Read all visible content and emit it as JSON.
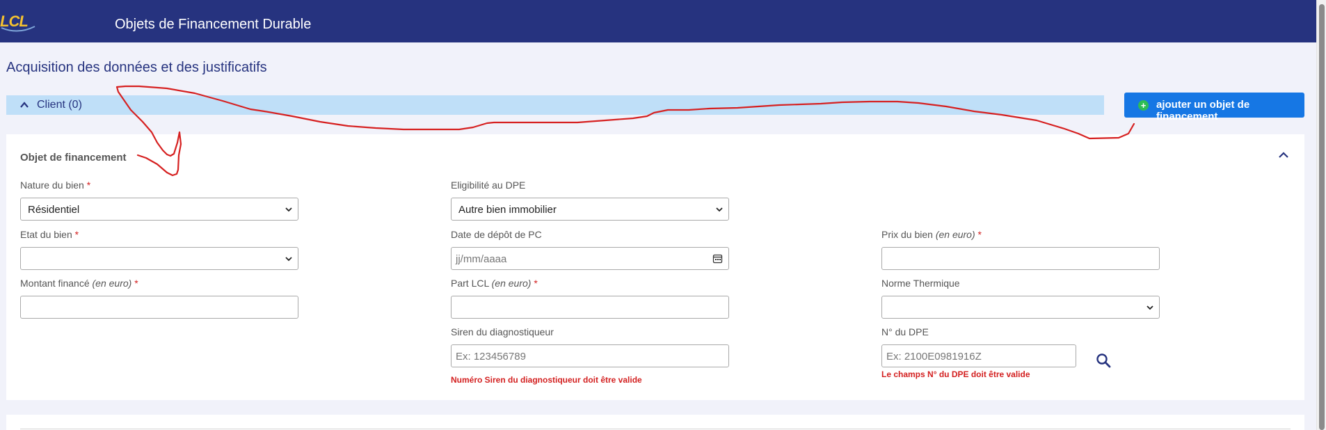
{
  "header": {
    "logo_text": "LCL",
    "title": "Objets de Financement Durable"
  },
  "page": {
    "title": "Acquisition des données et des justificatifs"
  },
  "client_section": {
    "label": "Client (0)"
  },
  "add_button": {
    "label": "ajouter un objet de financement",
    "icon": "plus-circle-icon"
  },
  "form": {
    "title": "Objet de financement",
    "nature": {
      "label": "Nature du bien",
      "required": "*",
      "value": "Résidentiel"
    },
    "eligibilite": {
      "label": "Eligibilité au DPE",
      "value": "Autre bien immobilier"
    },
    "etat": {
      "label": "Etat du bien",
      "required": "*",
      "value": ""
    },
    "date_pc": {
      "label": "Date de dépôt de PC",
      "placeholder": "jj/mm/aaaa"
    },
    "prix": {
      "label": "Prix du bien",
      "unit": "(en euro)",
      "required": "*",
      "value": ""
    },
    "montant": {
      "label": "Montant financé",
      "unit": "(en euro)",
      "required": "*",
      "value": ""
    },
    "part_lcl": {
      "label": "Part LCL",
      "unit": "(en euro)",
      "required": "*",
      "value": ""
    },
    "norme": {
      "label": "Norme Thermique",
      "value": ""
    },
    "siren": {
      "label": "Siren du diagnostiqueur",
      "placeholder": "Ex: 123456789",
      "error": "Numéro Siren du diagnostiqueur doit être valide"
    },
    "dpe": {
      "label": "N° du DPE",
      "placeholder": "Ex: 2100E0981916Z",
      "error": "Le champs N° du DPE doit être valide"
    }
  },
  "colors": {
    "header": "#26337f",
    "client_bar": "#bfdff8",
    "button": "#1677e4",
    "error": "#d32020",
    "annotation": "#d62020"
  }
}
